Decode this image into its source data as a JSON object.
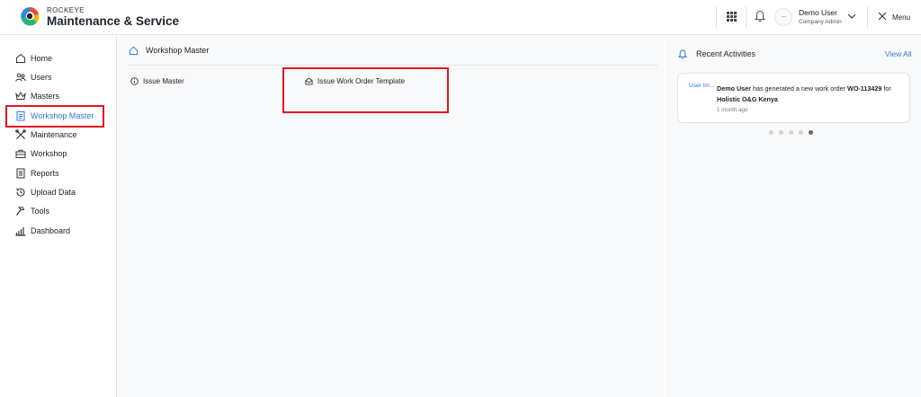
{
  "header": {
    "brand_small": "ROCKEYE",
    "brand_title": "Maintenance & Service",
    "user_name": "Demo User",
    "user_role": "Company Admin",
    "menu_label": "Menu",
    "icons": [
      "apps-grid-icon",
      "bell-icon",
      "avatar-icon",
      "chevron-down-icon",
      "close-icon"
    ]
  },
  "sidebar": {
    "items": [
      {
        "label": "Home",
        "icon": "home-icon"
      },
      {
        "label": "Users",
        "icon": "users-icon"
      },
      {
        "label": "Masters",
        "icon": "crown-icon"
      },
      {
        "label": "Workshop Master",
        "icon": "clipboard-icon",
        "active": true
      },
      {
        "label": "Maintenance",
        "icon": "tools-icon"
      },
      {
        "label": "Workshop",
        "icon": "toolbox-icon"
      },
      {
        "label": "Reports",
        "icon": "report-icon"
      },
      {
        "label": "Upload Data",
        "icon": "history-icon"
      },
      {
        "label": "Tools",
        "icon": "hammer-icon"
      },
      {
        "label": "Dashboard",
        "icon": "bar-chart-icon"
      }
    ]
  },
  "main": {
    "title": "Workshop Master",
    "items": [
      {
        "label": "Issue Master",
        "icon": "info-icon"
      },
      {
        "label": "Issue Work Order Template",
        "icon": "envelope-open-icon"
      }
    ]
  },
  "activities": {
    "title": "Recent Activities",
    "view_all": "View All",
    "card": {
      "image_alt": "User Im...",
      "user": "Demo User",
      "text_mid": " has generated a new work order ",
      "order_id": "WO-113429",
      "text_for": " for",
      "company": "Holistic O&G Kenya",
      "time": "1 month ago"
    },
    "page_count": 5,
    "active_page": 5
  },
  "colors": {
    "accent": "#2b7ad6",
    "highlight_border": "#e0191f",
    "main_bg": "#f8f9fa"
  }
}
